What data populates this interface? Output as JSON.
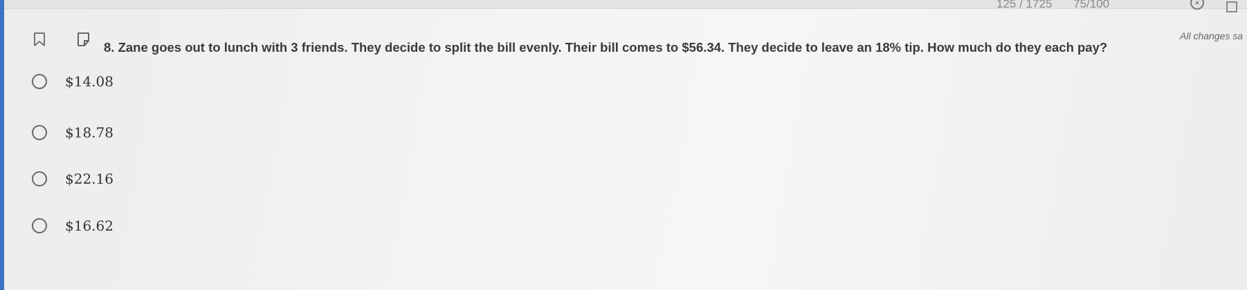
{
  "header": {
    "progress_text": "125 / 1725",
    "score_text": "75/100",
    "save_status": "All changes sa"
  },
  "icons": {
    "bookmark": "bookmark-icon",
    "note": "note-icon",
    "close": "close-icon",
    "fullscreen": "fullscreen-icon"
  },
  "colors": {
    "accent": "#3f72c4",
    "background": "#f3f3f1"
  },
  "question": {
    "text": "8. Zane goes out to lunch with 3 friends. They decide to split the bill evenly. Their bill comes to $56.34. They decide to leave an 18% tip. How much do they each pay?"
  },
  "choices": [
    {
      "label": "$14.08"
    },
    {
      "label": "$18.78"
    },
    {
      "label": "$22.16"
    },
    {
      "label": "$16.62"
    }
  ]
}
